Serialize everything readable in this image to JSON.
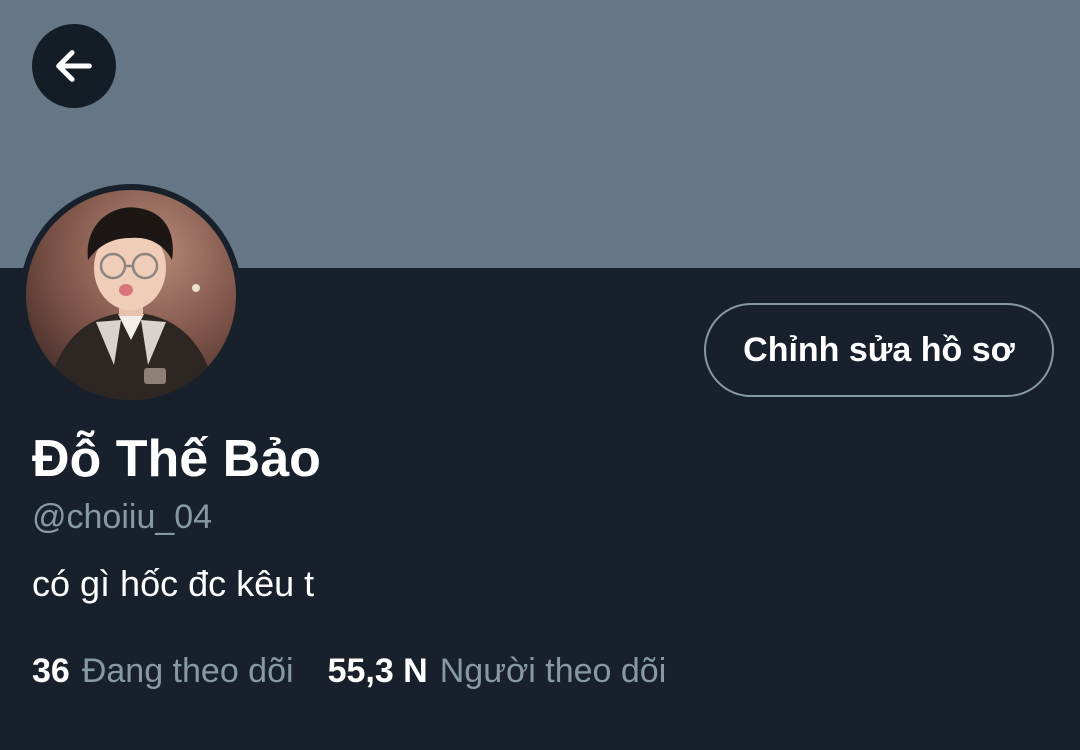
{
  "profile": {
    "display_name": "Đỗ Thế Bảo",
    "handle": "@choiiu_04",
    "bio": "có gì hốc đc kêu t",
    "edit_button_label": "Chỉnh sửa hồ sơ"
  },
  "stats": {
    "following_count": "36",
    "following_label": "Đang theo dõi",
    "followers_count": "55,3 N",
    "followers_label": "Người theo dõi"
  },
  "icons": {
    "back": "arrow-left-icon"
  },
  "colors": {
    "background": "#17202b",
    "banner": "#657786",
    "secondary_text": "#8899a6",
    "primary_text": "#ffffff"
  }
}
